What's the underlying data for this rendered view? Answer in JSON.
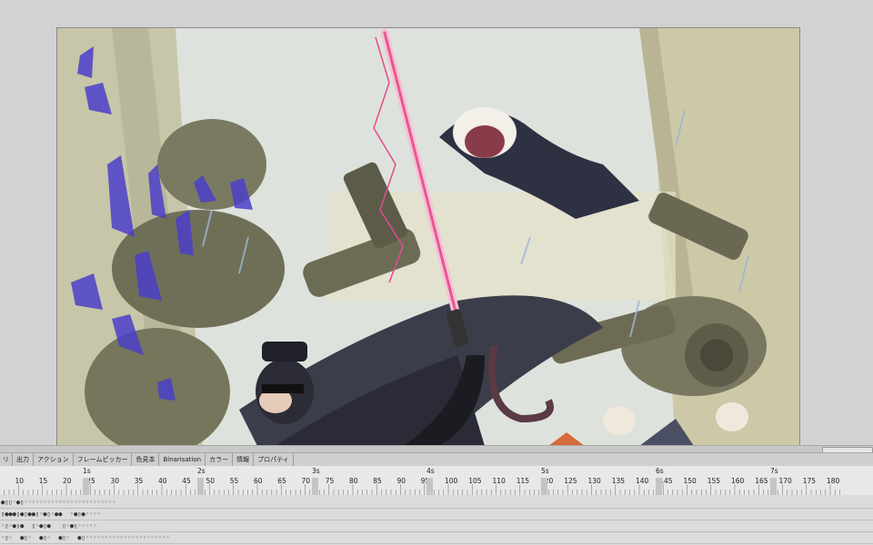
{
  "tabs": [
    {
      "label": "リ"
    },
    {
      "label": "出力"
    },
    {
      "label": "アクション"
    },
    {
      "label": "フレームピッカー"
    },
    {
      "label": "色見本"
    },
    {
      "label": "Binarisation"
    },
    {
      "label": "カラー"
    },
    {
      "label": "情報"
    },
    {
      "label": "プロパティ"
    }
  ],
  "ruler": {
    "frame_numbers": [
      "10",
      "15",
      "20",
      "25",
      "30",
      "35",
      "40",
      "45",
      "50",
      "55",
      "60",
      "65",
      "70",
      "75",
      "80",
      "85",
      "90",
      "95",
      "100",
      "105",
      "110",
      "115",
      "120",
      "125",
      "130",
      "135",
      "140",
      "145",
      "150",
      "155",
      "160",
      "165",
      "170",
      "175",
      "180"
    ],
    "seconds": [
      "1s",
      "2s",
      "3s",
      "4s",
      "5s",
      "6s",
      "7s"
    ]
  },
  "tracks": [
    "●▯▯◦●▯◦◦◦◦◦◦◦◦◦◦◦◦◦◦◦◦◦◦◦◦◦◦◦◦",
    "▯●●●▯●▯●●▯◦●▯◦●●  ◦●▯●◦◦◦◦",
    "◦▯◦●▯●  ▯◦●▯●   ▯◦●▯◦◦◦◦◦",
    "◦▯◦  ●▯◦  ●▯◦  ●▯◦  ●▯◦◦◦◦◦◦◦◦◦◦◦◦◦◦◦◦◦◦◦◦◦◦"
  ],
  "artwork": {
    "description_icon": "comic-artwork-image"
  }
}
